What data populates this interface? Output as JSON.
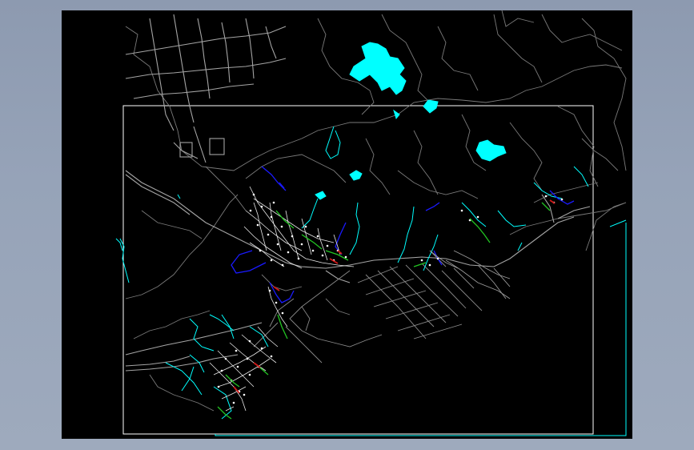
{
  "app": {
    "title": "",
    "background_color": "#9aa6b9"
  },
  "drawing": {
    "canvas_color": "#000000",
    "layers": [
      {
        "name": "roads",
        "color": "#9a9a9a"
      },
      {
        "name": "water",
        "color": "#00ffff"
      },
      {
        "name": "streams",
        "color": "#00ffff"
      },
      {
        "name": "drainage",
        "color": "#1010ff"
      },
      {
        "name": "frame",
        "color": "#ffffff"
      },
      {
        "name": "frame-secondary",
        "color": "#00ffff"
      },
      {
        "name": "network-main",
        "color": "#22c522"
      },
      {
        "name": "network-nodes",
        "color": "#ffffff"
      },
      {
        "name": "network-red",
        "color": "#d01818"
      }
    ]
  }
}
